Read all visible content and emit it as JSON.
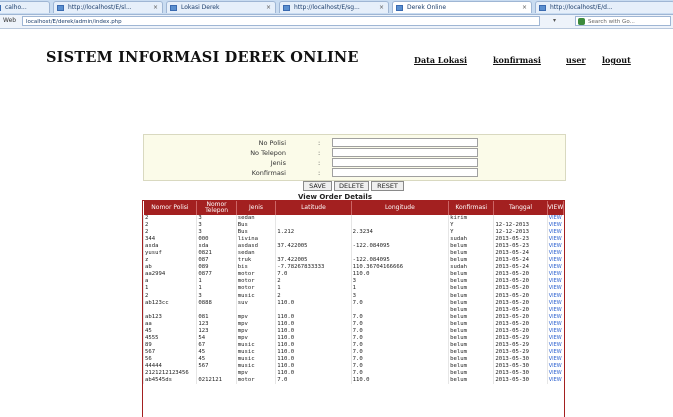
{
  "browser": {
    "tabs": [
      {
        "label": "calho..."
      },
      {
        "label": "http://localhost/E/sl..."
      },
      {
        "label": "Lokasi Derek"
      },
      {
        "label": "http://localhost/E/sg..."
      },
      {
        "label": "Derek Online"
      },
      {
        "label": "http://localhost/E/d..."
      }
    ],
    "nav_label": "Web",
    "url": "localhost/E/derek/admin/index.php",
    "dropdown_glyph": "▾",
    "search_placeholder": "Search with Go..."
  },
  "header": {
    "title": "SISTEM INFORMASI DEREK ONLINE",
    "nav": [
      "Data Lokasi",
      "konfirmasi",
      "user",
      "logout"
    ]
  },
  "form": {
    "fields": [
      {
        "label": "No Polisi",
        "sep": ":",
        "value": ""
      },
      {
        "label": "No Telepon",
        "sep": ":",
        "value": ""
      },
      {
        "label": "Jenis",
        "sep": ":",
        "value": ""
      },
      {
        "label": "Konfirmasi",
        "sep": ":",
        "value": ""
      }
    ],
    "buttons": {
      "save": "SAVE",
      "delete": "DELETE",
      "reset": "RESET"
    }
  },
  "orders": {
    "title": "View Order Details",
    "columns": [
      "Nomor Polisi",
      "Nomor Telepon",
      "Jenis",
      "Latitude",
      "Longitude",
      "Konfirmasi",
      "Tanggal",
      "VIEW"
    ],
    "rows": [
      [
        "2",
        "3",
        "sedan",
        "",
        "",
        "kirim",
        "",
        "VIEW"
      ],
      [
        "2",
        "3",
        "Bus",
        "",
        "",
        "Y",
        "12-12-2013",
        "VIEW"
      ],
      [
        "2",
        "3",
        "Bus",
        "1.212",
        "2.3234",
        "Y",
        "12-12-2013",
        "VIEW"
      ],
      [
        "344",
        "000",
        "livina",
        "",
        "",
        "sudah",
        "2013-05-23",
        "VIEW"
      ],
      [
        "asda",
        "sda",
        "asdasd",
        "37.422005",
        "-122.084095",
        "belum",
        "2013-05-23",
        "VIEW"
      ],
      [
        "yusuf",
        "0821",
        "sedan",
        "",
        "",
        "belum",
        "2013-05-24",
        "VIEW"
      ],
      [
        "z",
        "087",
        "truk",
        "37.422005",
        "-122.084095",
        "belum",
        "2013-05-24",
        "VIEW"
      ],
      [
        "ab",
        "089",
        "bis",
        "-7.78267833333",
        "110.36704166666",
        "sudah",
        "2013-05-24",
        "VIEW"
      ],
      [
        "aa2994",
        "0877",
        "motor",
        "7.0",
        "110.0",
        "belum",
        "2013-05-20",
        "VIEW"
      ],
      [
        "a",
        "1",
        "motor",
        "2",
        "3",
        "belum",
        "2013-05-20",
        "VIEW"
      ],
      [
        "1",
        "1",
        "motor",
        "1",
        "1",
        "belum",
        "2013-05-20",
        "VIEW"
      ],
      [
        "2",
        "3",
        "music",
        "2",
        "3",
        "belum",
        "2013-05-20",
        "VIEW"
      ],
      [
        "ab123cc",
        "0888",
        "suv",
        "110.0",
        "7.0",
        "belum",
        "2013-05-20",
        "VIEW"
      ],
      [
        "",
        "",
        "",
        "",
        "",
        "belum",
        "2013-05-20",
        "VIEW"
      ],
      [
        "ab123",
        "081",
        "mpv",
        "110.0",
        "7.0",
        "belum",
        "2013-05-20",
        "VIEW"
      ],
      [
        "aa",
        "123",
        "mpv",
        "110.0",
        "7.0",
        "belum",
        "2013-05-20",
        "VIEW"
      ],
      [
        "45",
        "123",
        "mpv",
        "110.0",
        "7.0",
        "belum",
        "2013-05-20",
        "VIEW"
      ],
      [
        "4555",
        "54",
        "mpv",
        "110.0",
        "7.0",
        "belum",
        "2013-05-29",
        "VIEW"
      ],
      [
        "89",
        "67",
        "music",
        "110.0",
        "7.0",
        "belum",
        "2013-05-29",
        "VIEW"
      ],
      [
        "567",
        "45",
        "music",
        "110.0",
        "7.0",
        "belum",
        "2013-05-29",
        "VIEW"
      ],
      [
        "56",
        "45",
        "music",
        "110.0",
        "7.0",
        "belum",
        "2013-05-30",
        "VIEW"
      ],
      [
        "44444",
        "567",
        "music",
        "110.0",
        "7.0",
        "belum",
        "2013-05-30",
        "VIEW"
      ],
      [
        "2121212123456",
        "",
        "mpv",
        "110.0",
        "7.0",
        "belum",
        "2013-05-30",
        "VIEW"
      ],
      [
        "ab4545ds",
        "0212121",
        "motor",
        "7.0",
        "110.0",
        "belum",
        "2013-05-30",
        "VIEW"
      ]
    ]
  },
  "colors": {
    "table_header": "#a32020",
    "form_bg": "#fbfbe9",
    "view_link": "#2a5fcf"
  }
}
